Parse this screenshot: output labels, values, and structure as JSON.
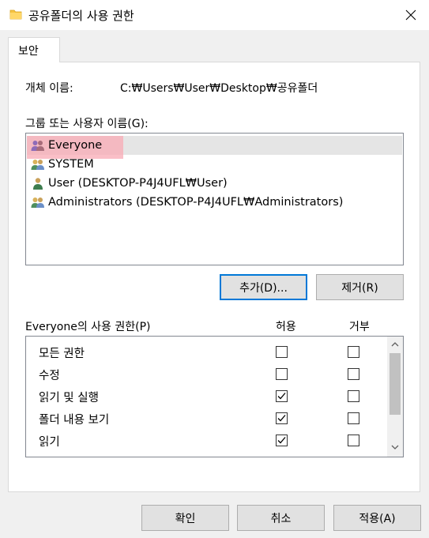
{
  "window": {
    "title": "공유폴더의 사용 권한"
  },
  "tabs": [
    {
      "label": "보안"
    }
  ],
  "object": {
    "label": "개체 이름:",
    "value": "C:₩Users₩User₩Desktop₩공유폴더"
  },
  "groups": {
    "label": "그룹 또는 사용자 이름(G):",
    "items": [
      {
        "label": "Everyone"
      },
      {
        "label": "SYSTEM"
      },
      {
        "label": "User (DESKTOP-P4J4UFL₩User)"
      },
      {
        "label": "Administrators (DESKTOP-P4J4UFL₩Administrators)"
      }
    ]
  },
  "buttons": {
    "add": "추가(D)...",
    "remove": "제거(R)",
    "ok": "확인",
    "cancel": "취소",
    "apply": "적용(A)"
  },
  "permissions": {
    "label": "Everyone의 사용 권한(P)",
    "allow_header": "허용",
    "deny_header": "거부",
    "rows": [
      {
        "label": "모든 권한",
        "allow": false,
        "deny": false
      },
      {
        "label": "수정",
        "allow": false,
        "deny": false
      },
      {
        "label": "읽기 및 실행",
        "allow": true,
        "deny": false
      },
      {
        "label": "폴더 내용 보기",
        "allow": true,
        "deny": false
      },
      {
        "label": "읽기",
        "allow": true,
        "deny": false
      }
    ]
  },
  "colors": {
    "highlight": "#f8aab4",
    "selected": "#e5e5e5",
    "accent": "#0078d7",
    "folder": "#f5c342"
  }
}
